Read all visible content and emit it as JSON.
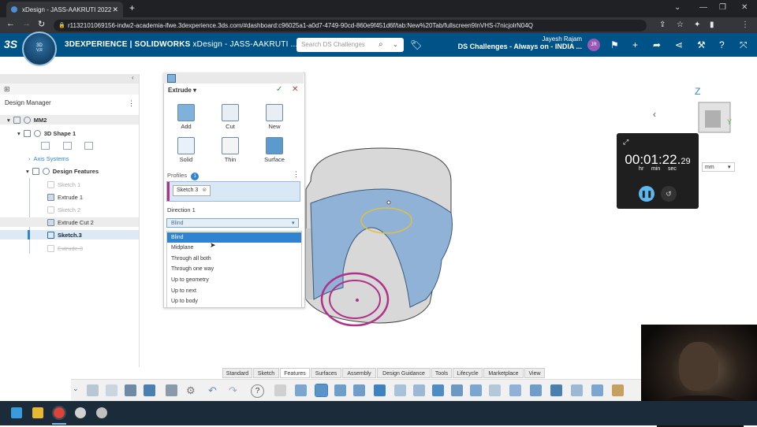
{
  "browser": {
    "tab_title": "xDesign - JASS-AAKRUTI 2022",
    "url": "r1132101069156-indw2-academia-ifwe.3dexperience.3ds.com/#dashboard:c96025a1-a0d7-4749-90cd-860e9f451d6f/tab:New%20Tab/fullscreen9InVHS-i7nicjolrN04Q"
  },
  "app_bar": {
    "brand_bold": "3DEXPERIENCE | SOLIDWORKS",
    "brand_app": "xDesign - JASS-AAKRUTI ...",
    "search_placeholder": "Search DS Challenges",
    "user_name": "Jayesh Rajam",
    "community": "DS Challenges - Always on - INDIA ...",
    "avatar_initials": "JR",
    "compass_label": "V,R"
  },
  "design_manager": {
    "title": "Design Manager",
    "root": "MM2",
    "shape": "3D Shape 1",
    "axis": "Axis Systems",
    "features": "Design Features",
    "items": [
      {
        "label": "Sketch 1"
      },
      {
        "label": "Extrude 1"
      },
      {
        "label": "Sketch 2"
      },
      {
        "label": "Extrude Cut 2"
      },
      {
        "label": "Sketch.3"
      },
      {
        "label": "Extrude.3"
      }
    ]
  },
  "extrude_panel": {
    "title": "Extrude",
    "buttons": [
      "Add",
      "Cut",
      "New",
      "Solid",
      "Thin",
      "Surface"
    ],
    "profiles_label": "Profiles",
    "profiles_count": "1",
    "profile_chip": "Sketch 3",
    "direction_label": "Direction 1",
    "direction_value": "Blind",
    "options": [
      "Blind",
      "Midplane",
      "Through all both",
      "Through one way",
      "Up to geometry",
      "Up to next",
      "Up to body"
    ]
  },
  "timer": {
    "time": "00:01:22.",
    "hundredths": "29",
    "units": [
      "hr",
      "min",
      "sec"
    ]
  },
  "unit_select": "mm",
  "nav_cube": {
    "axis_z": "Z",
    "axis_y": "Y"
  },
  "tool_tabs": [
    "Standard",
    "Sketch",
    "Features",
    "Surfaces",
    "Assembly",
    "Design Guidance",
    "Tools",
    "Lifecycle",
    "Marketplace",
    "View"
  ],
  "colors": {
    "app_bar": "#005386",
    "accent_blue": "#2f83d0",
    "model_face": "#8fb2d6",
    "sketch_ring": "#b0308a"
  }
}
